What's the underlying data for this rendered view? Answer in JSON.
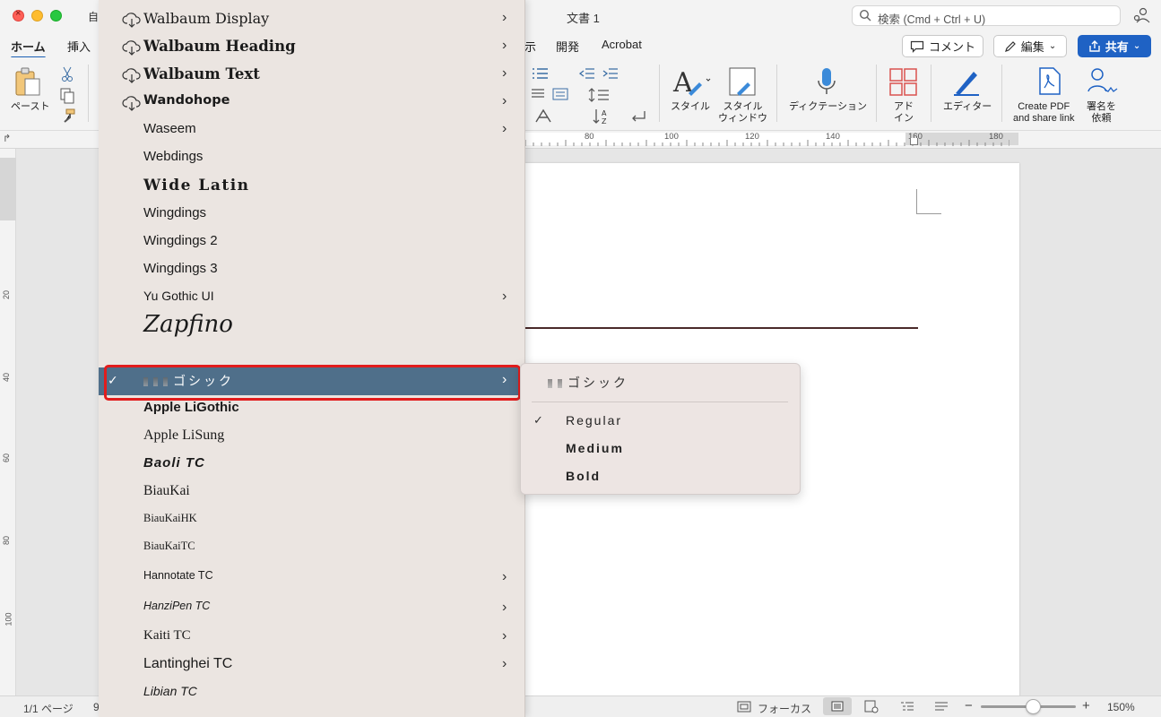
{
  "window": {
    "title_left": "自",
    "doc_title": "文書 1",
    "search_placeholder": "検索 (Cmd + Ctrl + U)"
  },
  "tabs": [
    "ホーム",
    "挿入",
    "示",
    "開発",
    "Acrobat"
  ],
  "header_buttons": {
    "comment": "コメント",
    "edit": "編集",
    "share": "共有"
  },
  "ribbon": {
    "paste": "ペースト",
    "style": "スタイル",
    "style_window_1": "スタイル",
    "style_window_2": "ウィンドウ",
    "dictation": "ディクテーション",
    "addin_1": "アド",
    "addin_2": "イン",
    "editor": "エディター",
    "create_pdf_1": "Create PDF",
    "create_pdf_2": "and share link",
    "sign_1": "署名を",
    "sign_2": "依頼"
  },
  "ruler": {
    "numbers": [
      "80",
      "100",
      "120",
      "140",
      "160",
      "180"
    ]
  },
  "vruler": {
    "numbers": [
      "20",
      "40",
      "60",
      "80",
      "100"
    ]
  },
  "font_menu": {
    "items": [
      {
        "name": "Walbaum Display",
        "cloud": true,
        "submenu": true
      },
      {
        "name": "Walbaum Heading",
        "cloud": true,
        "submenu": true
      },
      {
        "name": "Walbaum Text",
        "cloud": true,
        "submenu": true
      },
      {
        "name": "Wandohope",
        "cloud": true,
        "submenu": true
      },
      {
        "name": "Waseem",
        "cloud": false,
        "submenu": true
      },
      {
        "name": "Webdings",
        "cloud": false,
        "submenu": false
      },
      {
        "name": "Wide Latin",
        "cloud": false,
        "submenu": false
      },
      {
        "name": "Wingdings",
        "cloud": false,
        "submenu": false
      },
      {
        "name": "Wingdings 2",
        "cloud": false,
        "submenu": false
      },
      {
        "name": "Wingdings 3",
        "cloud": false,
        "submenu": false
      },
      {
        "name": "Yu Gothic UI",
        "cloud": false,
        "submenu": true
      },
      {
        "name": "Zapfino",
        "cloud": false,
        "submenu": false
      },
      {
        "name": "ゴシック",
        "cloud": false,
        "submenu": true,
        "selected": true
      },
      {
        "name": "Apple LiGothic",
        "cloud": false,
        "submenu": false
      },
      {
        "name": "Apple LiSung",
        "cloud": false,
        "submenu": false
      },
      {
        "name": "Baoli TC",
        "cloud": false,
        "submenu": false
      },
      {
        "name": "BiauKai",
        "cloud": false,
        "submenu": false
      },
      {
        "name": "BiauKaiHK",
        "cloud": false,
        "submenu": false
      },
      {
        "name": "BiauKaiTC",
        "cloud": false,
        "submenu": false
      },
      {
        "name": "Hannotate TC",
        "cloud": false,
        "submenu": true
      },
      {
        "name": "HanziPen TC",
        "cloud": false,
        "submenu": true
      },
      {
        "name": "Kaiti TC",
        "cloud": false,
        "submenu": true
      },
      {
        "name": "Lantinghei TC",
        "cloud": false,
        "submenu": true
      },
      {
        "name": "Libian TC",
        "cloud": false,
        "submenu": false
      }
    ]
  },
  "submenu": {
    "title": "ゴシック",
    "items": [
      {
        "label": "Regular",
        "checked": true
      },
      {
        "label": "Medium",
        "checked": false
      },
      {
        "label": "Bold",
        "checked": false
      }
    ]
  },
  "status": {
    "page": "1/1 ページ",
    "words": "9",
    "focus": "フォーカス",
    "zoom": "150%"
  }
}
